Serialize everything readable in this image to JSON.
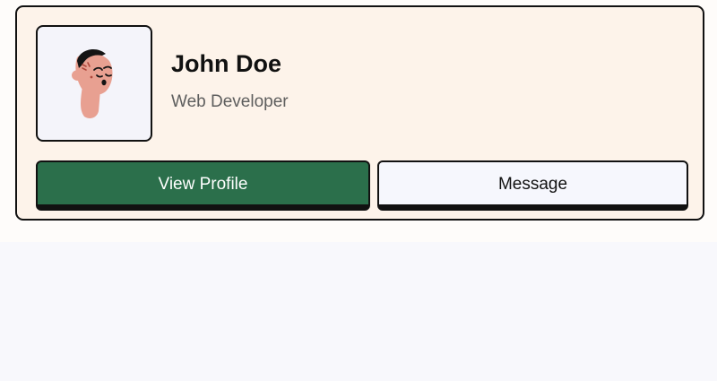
{
  "profile": {
    "name": "John Doe",
    "role": "Web Developer"
  },
  "actions": {
    "view_profile_label": "View Profile",
    "message_label": "Message"
  },
  "colors": {
    "card_background": "#fdf3ea",
    "primary_button": "#2b6f4b",
    "secondary_button": "#f6f7fd",
    "border": "#111111"
  },
  "icons": {
    "avatar": "cartoon-person-avatar"
  }
}
